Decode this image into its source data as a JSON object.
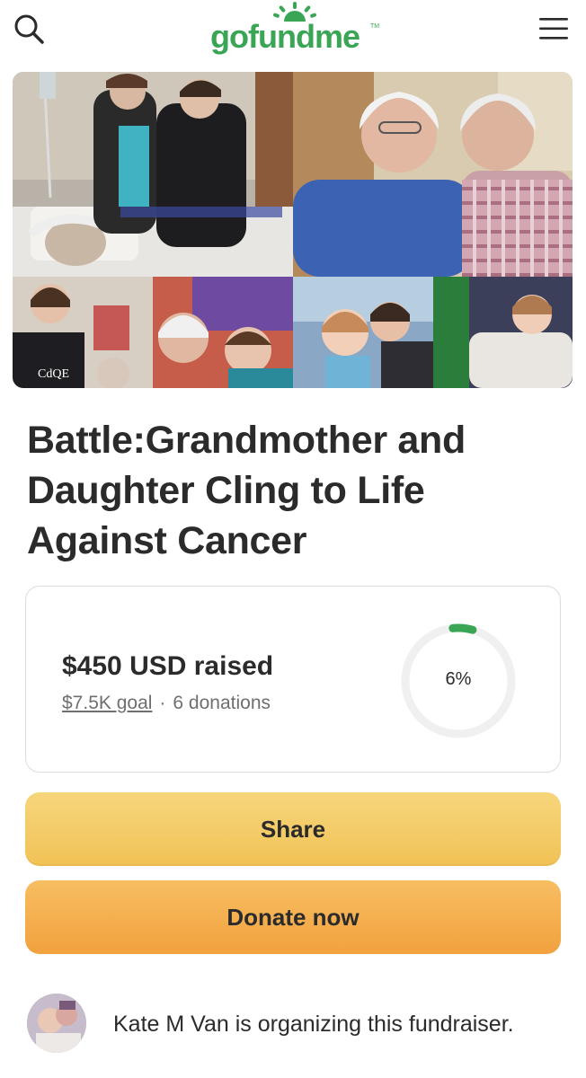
{
  "header": {
    "logo_text": "gofundme",
    "logo_tm": "TM",
    "brand_color": "#3aa655",
    "search_icon": "search-icon",
    "menu_icon": "hamburger-menu-icon"
  },
  "campaign": {
    "title": "Battle:Grandmother and Daughter Cling to Life Against Cancer",
    "hero_image_caption": "photo-collage"
  },
  "progress": {
    "raised": "$450 USD raised",
    "goal": "$7.5K goal",
    "separator": "·",
    "donations": "6 donations",
    "percent_label": "6%",
    "percent_value": 6,
    "ring_color": "#3aa655",
    "track_color": "#f0f0f0"
  },
  "actions": {
    "share_label": "Share",
    "donate_label": "Donate now"
  },
  "organizer": {
    "text": "Kate M Van is organizing this fundraiser."
  }
}
